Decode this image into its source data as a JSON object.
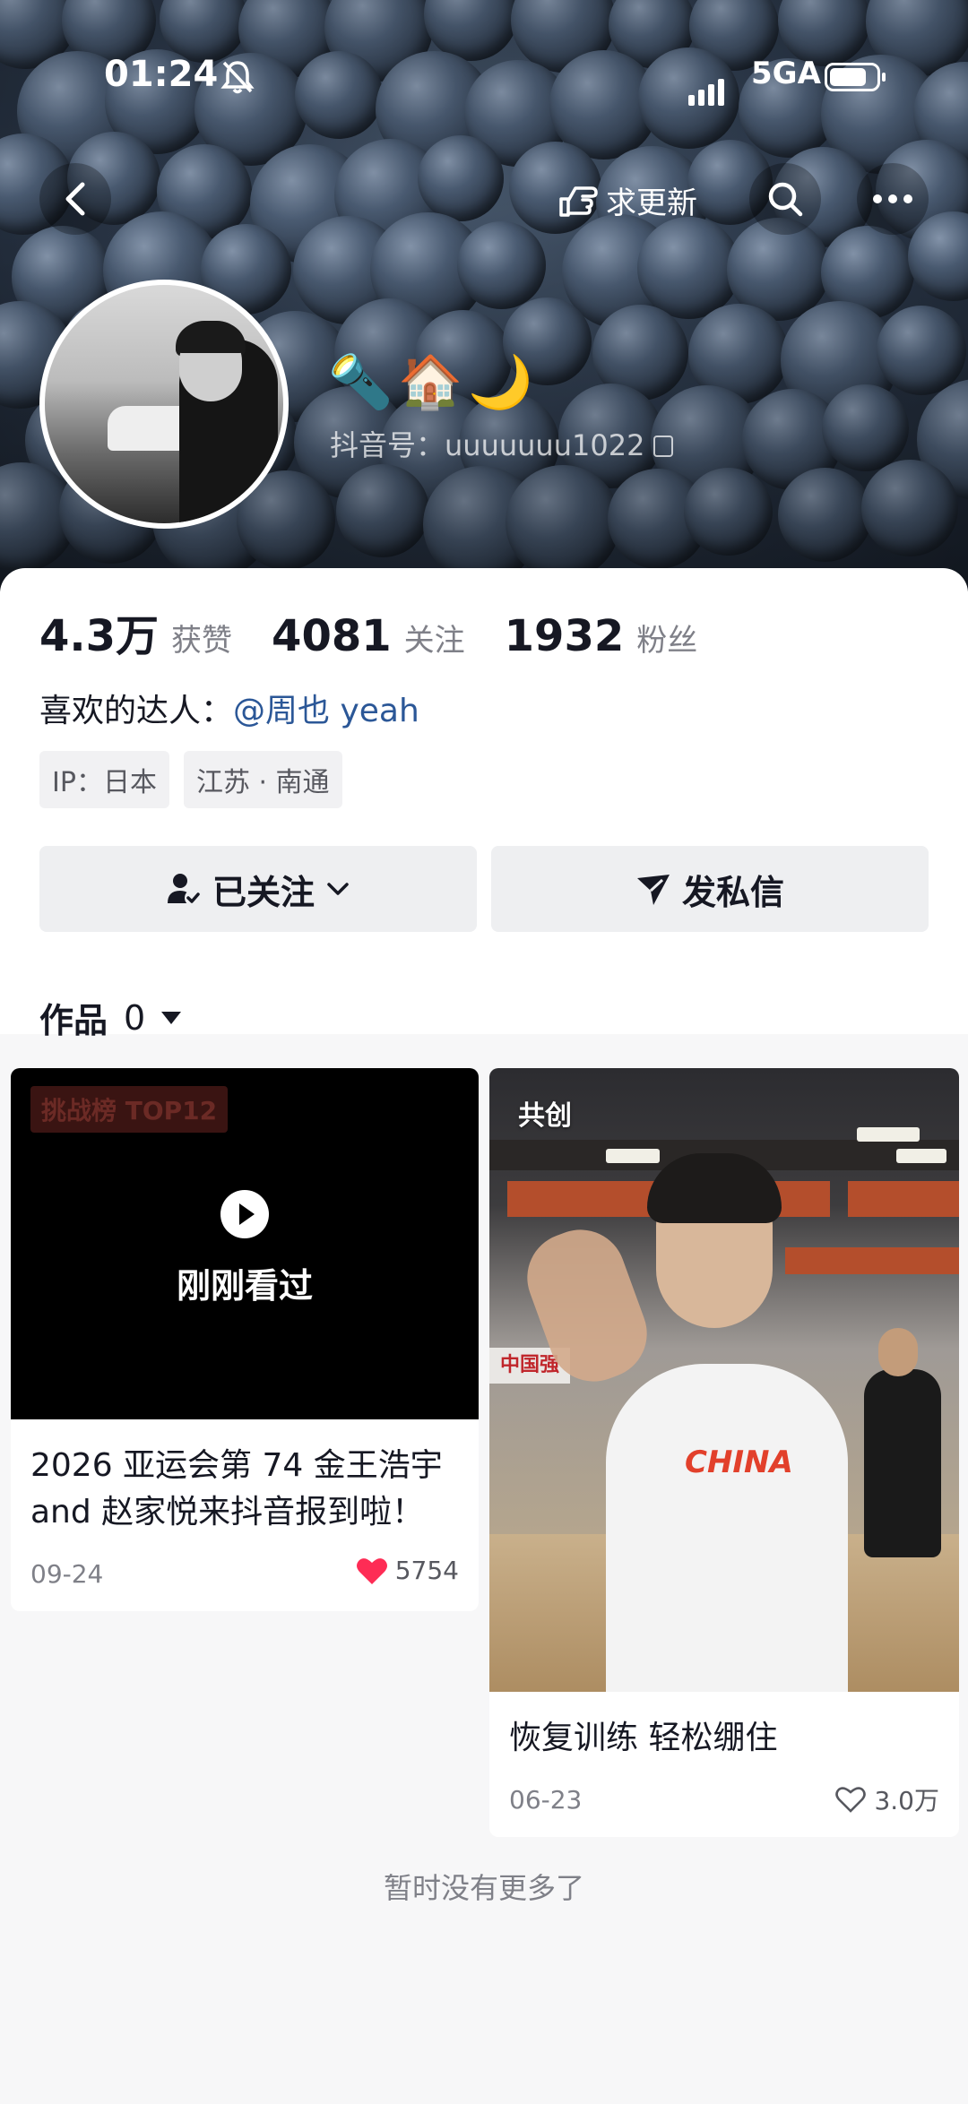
{
  "status_bar": {
    "time": "01:24",
    "network": "5GA"
  },
  "header": {
    "request_update_label": "求更新",
    "icons": [
      "back-arrow-icon",
      "request-update-hand-icon",
      "search-icon",
      "more-icon"
    ]
  },
  "profile": {
    "nickname_emojis": "🔦🏠🌙",
    "douyin_id_label": "抖音号：",
    "douyin_id": "uuuuuuu1022",
    "likes_count": "4.3万",
    "likes_label": "获赞",
    "following_count": "4081",
    "following_label": "关注",
    "followers_count": "1932",
    "followers_label": "粉丝",
    "fav_creator_label": "喜欢的达人：",
    "fav_creator_name": "@周也 yeah",
    "tags": [
      "IP：日本",
      "江苏 · 南通"
    ]
  },
  "actions": {
    "follow_label": "已关注",
    "message_label": "发私信"
  },
  "works": {
    "label": "作品",
    "count": "0"
  },
  "videos": [
    {
      "badge": "挑战榜 TOP12",
      "overlay_text": "刚刚看过",
      "title": "2026 亚运会第 74 金王浩宇 and 赵家悦来抖音报到啦！",
      "date": "09-24",
      "likes": "5754",
      "liked": true
    },
    {
      "badge": "共创",
      "title": "恢复训练 轻松绷住",
      "date": "06-23",
      "likes": "3.0万",
      "liked": false,
      "wall_text": "中国强",
      "shirt_text": "CHINA"
    }
  ],
  "footer": {
    "no_more_text": "暂时没有更多了"
  },
  "colors": {
    "accent_link": "#2b5797",
    "like_red": "#fe2c55",
    "text_primary": "#161823",
    "text_secondary": "#7f8088"
  }
}
